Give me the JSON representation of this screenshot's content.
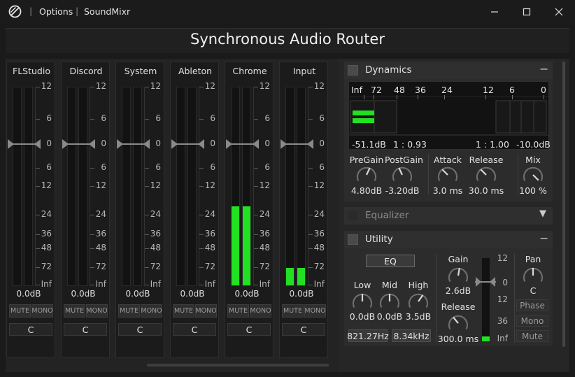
{
  "titlebar": {
    "menu_options": "Options",
    "app_name": "SoundMixr",
    "sep": "|"
  },
  "app_title": "Synchronous Audio Router",
  "scale_labels": [
    "12",
    "6",
    "0",
    "6",
    "12",
    "24",
    "36",
    "48",
    "72",
    "Inf"
  ],
  "channels": [
    {
      "name": "FLStudio",
      "db": "0.0dB",
      "mute": "MUTE",
      "mono": "MONO",
      "pan": "C",
      "level_left": 0,
      "level_right": 0
    },
    {
      "name": "Discord",
      "db": "0.0dB",
      "mute": "MUTE",
      "mono": "MONO",
      "pan": "C",
      "level_left": 0,
      "level_right": 0
    },
    {
      "name": "System",
      "db": "0.0dB",
      "mute": "MUTE",
      "mono": "MONO",
      "pan": "C",
      "level_left": 0,
      "level_right": 0
    },
    {
      "name": "Ableton",
      "db": "0.0dB",
      "mute": "MUTE",
      "mono": "MONO",
      "pan": "C",
      "level_left": 0,
      "level_right": 0
    },
    {
      "name": "Chrome",
      "db": "0.0dB",
      "mute": "MUTE",
      "mono": "MONO",
      "pan": "C",
      "level_left": 0.4,
      "level_right": 0.4
    },
    {
      "name": "Input",
      "db": "0.0dB",
      "mute": "MUTE",
      "mono": "MONO",
      "pan": "C",
      "level_left": 0.09,
      "level_right": 0.09
    }
  ],
  "dynamics": {
    "title": "Dynamics",
    "toggle": "−",
    "axis": [
      "Inf",
      "72",
      "48",
      "36",
      "24",
      "12",
      "6",
      "0"
    ],
    "readouts": {
      "left_db": "-51.1dB",
      "ratio_left": "1 : 0.93",
      "ratio_right": "1 : 1.00",
      "right_db": "-10.0dB"
    },
    "knobs": [
      {
        "label": "PreGain",
        "value": "4.80dB"
      },
      {
        "label": "PostGain",
        "value": "-3.20dB"
      },
      {
        "label": "Attack",
        "value": "3.0 ms"
      },
      {
        "label": "Release",
        "value": "30.0 ms"
      },
      {
        "label": "Mix",
        "value": "100 %"
      }
    ]
  },
  "equalizer": {
    "title": "Equalizer",
    "toggle": "▼"
  },
  "utility": {
    "title": "Utility",
    "toggle": "−",
    "eq_button": "EQ",
    "eq_knobs": [
      {
        "label": "Low",
        "value": "0.0dB"
      },
      {
        "label": "Mid",
        "value": "0.0dB"
      },
      {
        "label": "High",
        "value": "3.5dB"
      }
    ],
    "freq_low": "821.27Hz",
    "freq_high": "8.34kHz",
    "gain": {
      "label": "Gain",
      "value": "2.6dB"
    },
    "release": {
      "label": "Release",
      "value": "300.0 ms"
    },
    "meter_scale": [
      "12",
      "0",
      "12",
      "36",
      "Inf"
    ],
    "meter_level": 0.06,
    "pan": {
      "label": "Pan",
      "value": "C"
    },
    "phase": "Phase",
    "mono": "Mono",
    "mute": "Mute"
  },
  "colors": {
    "meter": "#22e022",
    "accent_bg": "#2f2f2f"
  }
}
